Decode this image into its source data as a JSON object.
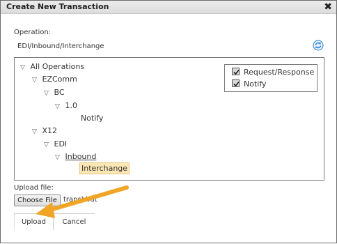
{
  "dialog": {
    "title": "Create New Transaction",
    "close_glyph": "✖"
  },
  "operation": {
    "label": "Operation:",
    "path": "EDI/Inbound/Interchange",
    "refresh_icon": "refresh-icon"
  },
  "tree": {
    "items": [
      {
        "label": "All Operations",
        "expanded": true
      },
      {
        "label": "EZComm",
        "expanded": true
      },
      {
        "label": "BC",
        "expanded": true
      },
      {
        "label": "1.0",
        "expanded": true
      },
      {
        "label": "Notify"
      },
      {
        "label": "X12",
        "expanded": true
      },
      {
        "label": "EDI",
        "expanded": true
      },
      {
        "label": "Inbound",
        "expanded": true,
        "underlined": true
      },
      {
        "label": "Interchange",
        "selected": true
      }
    ],
    "expand_glyph": "▽"
  },
  "filters": {
    "items": [
      {
        "label": "Request/Response",
        "checked": true
      },
      {
        "label": "Notify",
        "checked": true
      }
    ]
  },
  "upload": {
    "label": "Upload file:",
    "choose_button": "Choose File",
    "file_name": "transhbut"
  },
  "buttons": {
    "upload": "Upload",
    "cancel": "Cancel"
  },
  "colors": {
    "arrow": "#f0a526",
    "highlight": "#fde7b4",
    "refresh": "#2a7fd4"
  }
}
